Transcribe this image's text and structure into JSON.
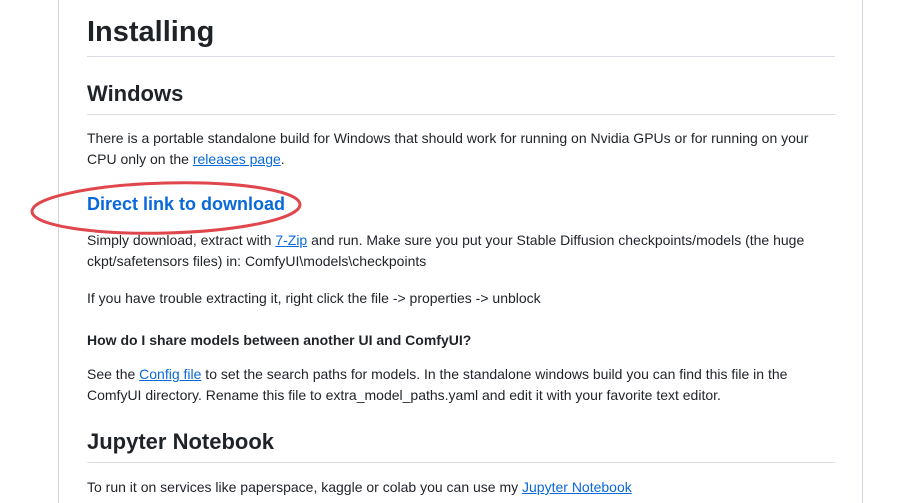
{
  "title": "Installing",
  "windows": {
    "heading": "Windows",
    "intro_before": "There is a portable standalone build for Windows that should work for running on Nvidia GPUs or for running on your CPU only on the ",
    "intro_link": "releases page",
    "intro_after": ".",
    "direct_link": "Direct link to download",
    "download_before": "Simply download, extract with ",
    "download_link": "7-Zip",
    "download_after": " and run. Make sure you put your Stable Diffusion checkpoints/models (the huge ckpt/safetensors files) in: ComfyUI\\models\\checkpoints",
    "trouble": "If you have trouble extracting it, right click the file -> properties -> unblock"
  },
  "share": {
    "heading": "How do I share models between another UI and ComfyUI?",
    "before": "See the ",
    "link": "Config file",
    "after": " to set the search paths for models. In the standalone windows build you can find this file in the ComfyUI directory. Rename this file to extra_model_paths.yaml and edit it with your favorite text editor."
  },
  "jupyter": {
    "heading": "Jupyter Notebook",
    "before": "To run it on services like paperspace, kaggle or colab you can use my ",
    "link": "Jupyter Notebook"
  },
  "colors": {
    "link": "#0969da",
    "annotation": "#e0474c",
    "text": "#1f2328"
  }
}
